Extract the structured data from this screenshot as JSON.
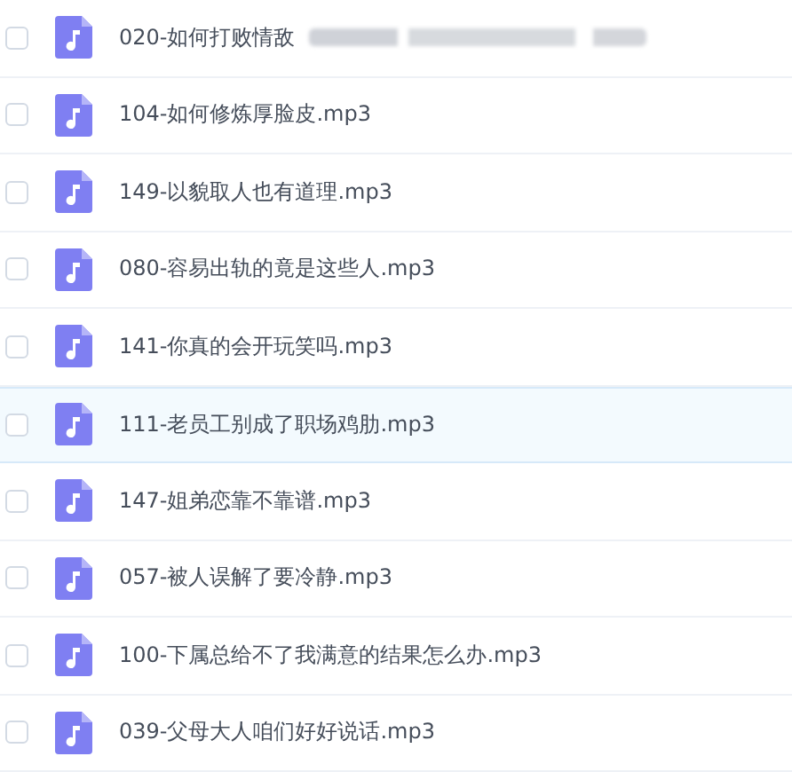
{
  "files": [
    {
      "name": "020-如何打败情敌",
      "checked": false,
      "hovered": false,
      "blurred_suffix": true
    },
    {
      "name": "104-如何修炼厚脸皮.mp3",
      "checked": false,
      "hovered": false,
      "blurred_suffix": false
    },
    {
      "name": "149-以貌取人也有道理.mp3",
      "checked": false,
      "hovered": false,
      "blurred_suffix": false
    },
    {
      "name": "080-容易出轨的竟是这些人.mp3",
      "checked": false,
      "hovered": false,
      "blurred_suffix": false
    },
    {
      "name": "141-你真的会开玩笑吗.mp3",
      "checked": false,
      "hovered": false,
      "blurred_suffix": false
    },
    {
      "name": "111-老员工别成了职场鸡肋.mp3",
      "checked": false,
      "hovered": true,
      "blurred_suffix": false
    },
    {
      "name": "147-姐弟恋靠不靠谱.mp3",
      "checked": false,
      "hovered": false,
      "blurred_suffix": false
    },
    {
      "name": "057-被人误解了要冷静.mp3",
      "checked": false,
      "hovered": false,
      "blurred_suffix": false
    },
    {
      "name": "100-下属总给不了我满意的结果怎么办.mp3",
      "checked": false,
      "hovered": false,
      "blurred_suffix": false
    },
    {
      "name": "039-父母大人咱们好好说话.mp3",
      "checked": false,
      "hovered": false,
      "blurred_suffix": false
    }
  ]
}
